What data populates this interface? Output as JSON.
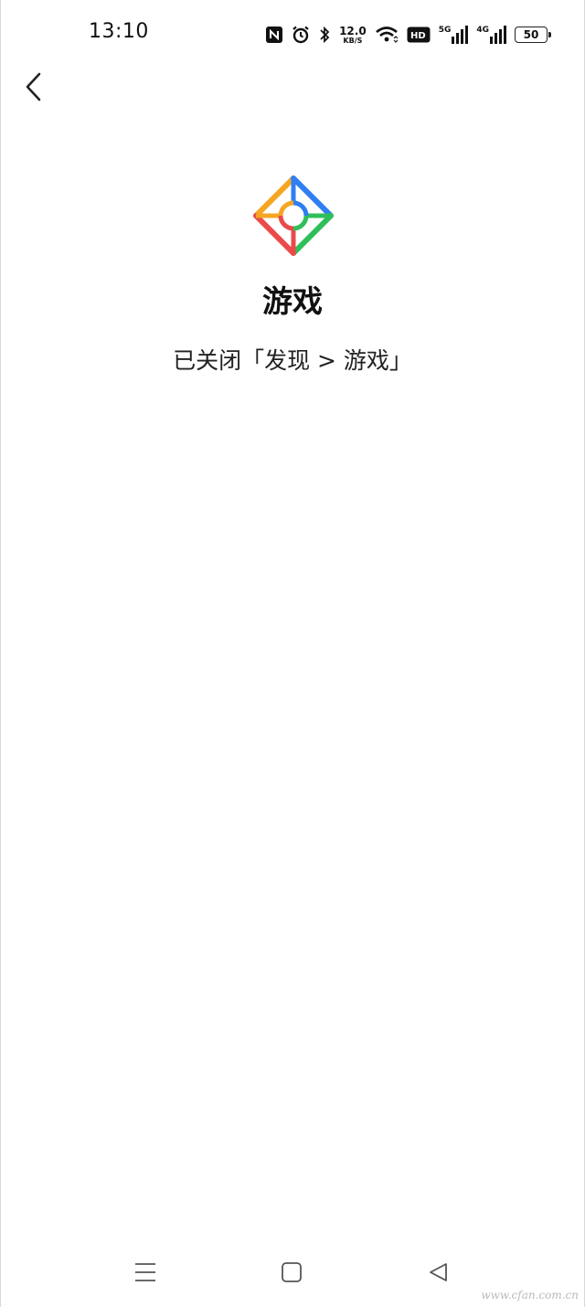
{
  "status_bar": {
    "time": "13:10",
    "net_speed_value": "12.0",
    "net_speed_unit": "KB/S",
    "hd_label": "HD",
    "signal_1_label": "5G",
    "signal_2_label": "4G",
    "battery_level": "50",
    "icons": [
      "nfc-icon",
      "alarm-icon",
      "bluetooth-icon",
      "wifi-icon",
      "hd-icon",
      "signal-5g-icon",
      "signal-4g-icon",
      "battery-icon"
    ]
  },
  "header": {
    "back_icon": "chevron-left-icon"
  },
  "content": {
    "app_icon": "game-center-icon",
    "title": "游戏",
    "message": "已关闭「发现 > 游戏」"
  },
  "nav_bar": {
    "icons": [
      "menu-icon",
      "home-icon",
      "back-triangle-icon"
    ]
  },
  "watermark": "www.cfan.com.cn",
  "colors": {
    "icon_orange": "#f5a623",
    "icon_blue": "#2f7ff2",
    "icon_green": "#2fbf5a",
    "icon_red": "#ea4a4a"
  }
}
